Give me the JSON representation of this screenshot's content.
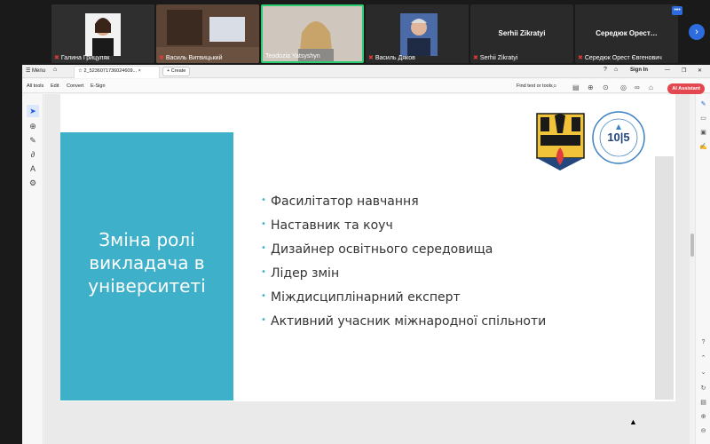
{
  "meeting": {
    "participants": [
      {
        "name": "Галина Грицуляк",
        "muted": true
      },
      {
        "name": "Василь Витвицький",
        "muted": true
      },
      {
        "name": "Teodozia Yatsyshyn",
        "muted": false
      },
      {
        "name": "Василь Дяков",
        "muted": true
      },
      {
        "name": "Serhii Zikratyi",
        "muted": true,
        "display": "Serhii Zikratyi"
      },
      {
        "name": "Середюк Орест Євгенович",
        "muted": true,
        "display": "Середюк Орест…"
      }
    ],
    "more_label": "•••",
    "next_label": "›"
  },
  "acrobat": {
    "menu_label": "Menu",
    "tab_title": "2_5236071736024609...",
    "new_tab_label": "+ Create",
    "sign_in": "Sign In",
    "menus": [
      "All tools",
      "Edit",
      "Convert",
      "E-Sign"
    ],
    "find_label": "Find text or tools",
    "ai_label": "AI Assistant"
  },
  "slide": {
    "title_lines": [
      "Зміна ролі",
      "викладача в",
      "університеті"
    ],
    "bullets": [
      "Фасилітатор навчання",
      "Наставник та коуч",
      "Дизайнер освітнього середовища",
      "Лідер змін",
      "Міждисциплінарний експерт",
      "Активний учасник міжнародної спільноти"
    ],
    "accent_color": "#3fb0c9",
    "logo2_center": "10|5"
  }
}
